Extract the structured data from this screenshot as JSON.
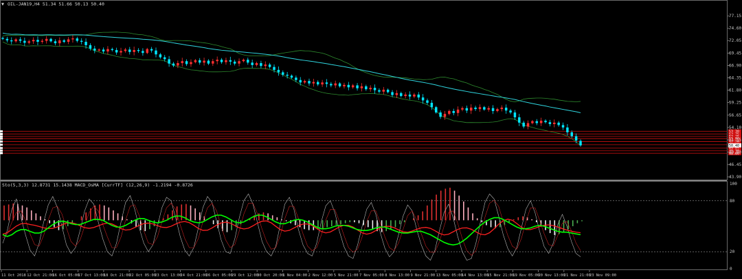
{
  "header": {
    "main_title": "OIL-JAN19,H4  51.34 51.66 50.13 50.40",
    "sub_title": "Sto(5,3,3) 12.8731 15.1438  MACD_OsMA [CurrTF] (12,26,9) -1.2194 -0.8726"
  },
  "colors": {
    "background": "#000000",
    "bull_candle": "#ff3030",
    "bear_candle": "#00e5ff",
    "ma_cyan": "#2fd6e0",
    "band_green": "#2e8b2e",
    "hline_red": "#d01010",
    "stoch_green": "#00ff00",
    "stoch_red": "#ff2020",
    "hist_red": "#e03030",
    "hist_pink": "#ffb0c0",
    "hist_green": "#4caf50",
    "hist_white": "#f0f0f0",
    "axis_text": "#c8c8c8"
  },
  "chart_data": [
    {
      "type": "candlestick",
      "symbol": "OIL-JAN19",
      "timeframe": "H4",
      "ohlc_last": {
        "open": 51.34,
        "high": 51.66,
        "low": 50.13,
        "close": 50.4
      },
      "ylim": [
        43.9,
        79.3
      ],
      "y_ticks": [
        "77.15",
        "74.60",
        "72.05",
        "69.45",
        "66.90",
        "64.35",
        "61.80",
        "59.25",
        "56.65",
        "54.10",
        "51.55",
        "49.00",
        "46.45",
        "43.90"
      ],
      "x_ticks": [
        "11 Oct 2018",
        "12 Oct 21:00",
        "16 Oct 05:00",
        "17 Oct 13:00",
        "18 Oct 21:00",
        "22 Oct 05:00",
        "23 Oct 13:00",
        "24 Oct 21:00",
        "26 Oct 05:00",
        "29 Oct 12:00",
        "30 Oct 20:00",
        "1 Nov 04:00",
        "2 Nov 12:00",
        "5 Nov 21:00",
        "7 Nov 05:00",
        "8 Nov 13:00",
        "9 Nov 21:00",
        "13 Nov 05:00",
        "14 Nov 13:00",
        "15 Nov 21:00",
        "19 Nov 05:00",
        "20 Nov 13:00",
        "21 Nov 21:00",
        "23 Nov 09:00"
      ],
      "close_series": [
        72.4,
        72.1,
        71.9,
        72.3,
        72.0,
        71.6,
        71.9,
        72.2,
        71.8,
        72.0,
        72.4,
        71.9,
        71.5,
        72.1,
        71.8,
        72.3,
        72.5,
        72.0,
        71.8,
        71.1,
        70.4,
        70.0,
        70.2,
        69.8,
        70.3,
        70.1,
        69.6,
        69.9,
        70.2,
        69.7,
        70.1,
        69.9,
        69.5,
        70.3,
        70.0,
        69.2,
        68.6,
        68.2,
        67.3,
        66.9,
        67.4,
        67.8,
        67.2,
        67.6,
        68.0,
        67.5,
        67.9,
        67.3,
        67.8,
        68.1,
        67.6,
        68.0,
        67.7,
        67.3,
        67.8,
        68.1,
        67.5,
        67.0,
        67.4,
        66.8,
        67.1,
        66.6,
        66.0,
        65.5,
        65.0,
        64.8,
        64.4,
        63.9,
        63.4,
        63.7,
        63.2,
        63.5,
        63.0,
        63.4,
        63.1,
        62.8,
        63.2,
        62.6,
        62.9,
        62.4,
        62.8,
        62.2,
        62.6,
        62.0,
        62.3,
        61.8,
        61.5,
        61.9,
        61.4,
        60.8,
        61.2,
        60.6,
        60.9,
        60.5,
        60.9,
        60.3,
        59.7,
        59.2,
        58.3,
        57.2,
        56.3,
        56.9,
        57.5,
        57.1,
        57.8,
        58.1,
        57.6,
        58.2,
        57.9,
        58.3,
        57.8,
        58.1,
        57.5,
        57.9,
        58.2,
        57.6,
        57.2,
        56.2,
        55.1,
        54.3,
        55.0,
        55.4,
        55.0,
        55.5,
        55.2,
        54.8,
        55.1,
        54.6,
        54.1,
        53.1,
        52.3,
        51.4,
        50.4
      ],
      "levels": [
        53.3,
        52.75,
        52.25,
        51.8,
        51.2,
        50.55,
        49.85,
        49.3,
        48.8
      ],
      "level_labels": [
        "53.30",
        "52.75",
        "52.25",
        "51.80",
        "51.20",
        "50.55",
        "49.85",
        "49.30",
        "48.80"
      ],
      "current_price_label": "50.40"
    },
    {
      "type": "line",
      "name": "Sto(5,3,3) + MACD_OsMA",
      "ylim": [
        0,
        100
      ],
      "y_ticks": [
        "100",
        "80",
        "20",
        "0"
      ],
      "stoch_k": [
        30,
        45,
        70,
        82,
        60,
        40,
        22,
        15,
        30,
        55,
        75,
        85,
        72,
        50,
        28,
        18,
        25,
        45,
        68,
        82,
        76,
        55,
        35,
        20,
        15,
        30,
        55,
        78,
        86,
        70,
        48,
        30,
        20,
        28,
        50,
        72,
        84,
        80,
        60,
        38,
        22,
        15,
        25,
        48,
        72,
        85,
        78,
        56,
        34,
        20,
        18,
        35,
        60,
        80,
        88,
        76,
        54,
        32,
        20,
        15,
        26,
        52,
        76,
        84,
        70,
        46,
        28,
        18,
        15,
        30,
        55,
        74,
        80,
        66,
        44,
        26,
        15,
        12,
        28,
        50,
        70,
        78,
        64,
        42,
        24,
        14,
        20,
        40,
        62,
        75,
        68,
        46,
        28,
        15,
        10,
        22,
        45,
        66,
        76,
        60,
        38,
        20,
        10,
        12,
        30,
        55,
        78,
        88,
        82,
        62,
        40,
        24,
        15,
        25,
        48,
        70,
        80,
        66,
        44,
        26,
        18,
        30,
        52,
        64,
        50,
        32,
        18,
        14
      ],
      "stoch_d": [
        35,
        40,
        55,
        68,
        70,
        58,
        40,
        26,
        24,
        38,
        58,
        74,
        76,
        66,
        48,
        30,
        24,
        32,
        50,
        68,
        76,
        70,
        52,
        36,
        22,
        22,
        36,
        58,
        76,
        78,
        64,
        44,
        28,
        26,
        36,
        56,
        74,
        80,
        72,
        52,
        34,
        22,
        22,
        34,
        56,
        74,
        80,
        70,
        50,
        32,
        22,
        26,
        44,
        66,
        80,
        80,
        66,
        46,
        30,
        20,
        22,
        38,
        60,
        76,
        76,
        60,
        40,
        24,
        18,
        22,
        38,
        58,
        72,
        72,
        56,
        38,
        22,
        16,
        20,
        36,
        56,
        70,
        70,
        54,
        36,
        22,
        18,
        28,
        46,
        64,
        70,
        58,
        40,
        24,
        16,
        16,
        30,
        50,
        68,
        70,
        54,
        34,
        18,
        12,
        18,
        38,
        62,
        80,
        84,
        76,
        56,
        38,
        24,
        20,
        34,
        56,
        74,
        74,
        58,
        40,
        26,
        24,
        38,
        54,
        56,
        44,
        28,
        18
      ],
      "slow_green": [
        40,
        38,
        40,
        44,
        46,
        46,
        44,
        42,
        42,
        44,
        48,
        52,
        55,
        56,
        55,
        53,
        52,
        52,
        54,
        56,
        58,
        58,
        57,
        54,
        51,
        49,
        49,
        51,
        54,
        57,
        59,
        59,
        57,
        55,
        54,
        55,
        57,
        60,
        62,
        62,
        60,
        57,
        55,
        54,
        55,
        58,
        61,
        63,
        63,
        61,
        58,
        55,
        54,
        55,
        58,
        61,
        63,
        63,
        61,
        58,
        55,
        53,
        53,
        55,
        57,
        58,
        57,
        55,
        52,
        49,
        47,
        47,
        48,
        50,
        51,
        51,
        50,
        48,
        46,
        45,
        45,
        46,
        48,
        49,
        49,
        47,
        45,
        43,
        42,
        42,
        43,
        44,
        44,
        42,
        40,
        37,
        34,
        31,
        29,
        28,
        29,
        32,
        36,
        41,
        46,
        51,
        55,
        58,
        60,
        60,
        58,
        55,
        52,
        49,
        47,
        47,
        48,
        50,
        51,
        50,
        48,
        46,
        44,
        43,
        43,
        42,
        41,
        40
      ],
      "hist": [
        30,
        32,
        34,
        33,
        30,
        26,
        20,
        14,
        8,
        2,
        -6,
        -14,
        -20,
        -18,
        -12,
        -6,
        0,
        8,
        16,
        24,
        30,
        32,
        30,
        26,
        20,
        14,
        8,
        2,
        -6,
        -14,
        -20,
        -22,
        -18,
        -12,
        -4,
        4,
        12,
        20,
        28,
        32,
        33,
        30,
        24,
        16,
        8,
        0,
        -8,
        -16,
        -22,
        -24,
        -20,
        -14,
        -8,
        -2,
        4,
        10,
        14,
        16,
        14,
        10,
        6,
        2,
        -2,
        -6,
        -10,
        -14,
        -18,
        -20,
        -20,
        -18,
        -16,
        -14,
        -12,
        -10,
        -8,
        -6,
        -4,
        -4,
        -6,
        -10,
        -14,
        -18,
        -22,
        -24,
        -22,
        -18,
        -14,
        -8,
        -4,
        0,
        4,
        10,
        18,
        30,
        42,
        52,
        60,
        64,
        66,
        60,
        50,
        38,
        26,
        14,
        4,
        -4,
        -10,
        -14,
        -16,
        -14,
        -10,
        -4,
        2,
        6,
        8,
        6,
        2,
        -4,
        -12,
        -20,
        -26,
        -30,
        -28,
        -24,
        -18,
        -12,
        -6,
        -2
      ],
      "hist_zero": 57,
      "hist_scale": 0.72
    }
  ]
}
